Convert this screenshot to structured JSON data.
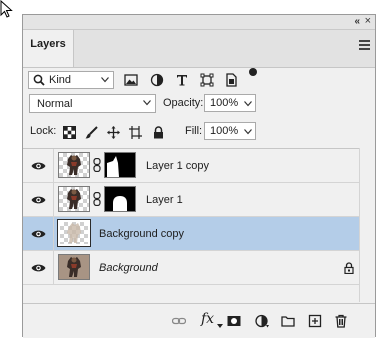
{
  "panel": {
    "tab_label": "Layers",
    "collapse_glyph": "«",
    "close_glyph": "×"
  },
  "filter": {
    "kind_label": "Kind",
    "icons": [
      "image-filter-icon",
      "adjustment-filter-icon",
      "type-filter-icon",
      "shape-filter-icon",
      "smart-object-filter-icon"
    ]
  },
  "blend": {
    "mode": "Normal",
    "opacity_label": "Opacity:",
    "opacity_value": "100%"
  },
  "locks": {
    "lock_label": "Lock:",
    "fill_label": "Fill:",
    "fill_value": "100%"
  },
  "layers": [
    {
      "name": "Layer 1 copy",
      "visible": true,
      "has_mask": true,
      "selected": false
    },
    {
      "name": "Layer 1",
      "visible": true,
      "has_mask": true,
      "selected": false
    },
    {
      "name": "Background copy",
      "visible": true,
      "has_mask": false,
      "selected": true
    },
    {
      "name": "Background",
      "visible": true,
      "has_mask": false,
      "locked": true,
      "italic": true
    }
  ],
  "footer": {
    "fx_label": "fx",
    "icons": [
      "link-layers-icon",
      "layer-style-icon",
      "add-mask-icon",
      "adjustment-layer-icon",
      "new-group-icon",
      "new-layer-icon",
      "delete-layer-icon"
    ]
  },
  "colors": {
    "selected_row": "#b4cde8",
    "panel_bg": "#f0f0f0"
  }
}
